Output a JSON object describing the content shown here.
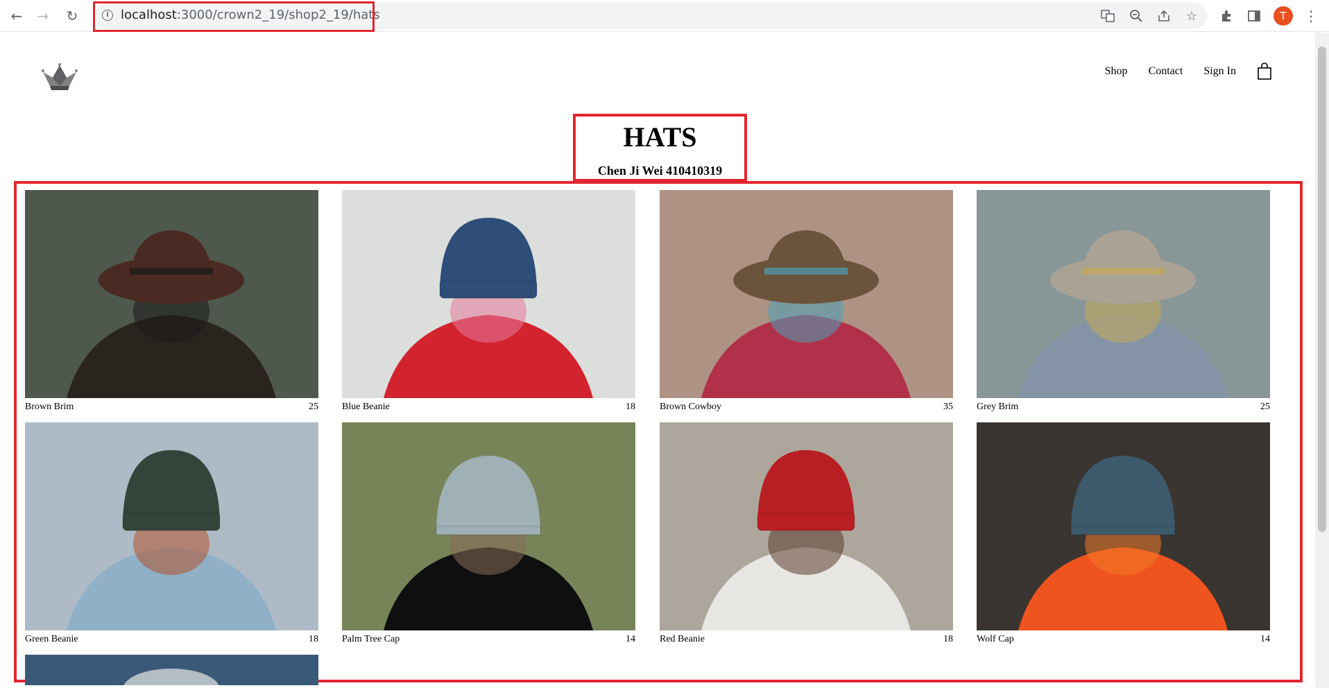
{
  "browser": {
    "url_host": "localhost",
    "url_path": ":3000/crown2_19/shop2_19/hats",
    "avatar_letter": "T"
  },
  "header": {
    "nav": [
      "Shop",
      "Contact",
      "Sign In"
    ]
  },
  "page": {
    "title": "HATS",
    "subtitle": "Chen Ji Wei 410410319"
  },
  "products": [
    {
      "name": "Brown Brim",
      "price": "25",
      "bg": "#3f4a3e",
      "hat": "#4a2a22",
      "body": "#2a241f",
      "accent": "#1a1a18"
    },
    {
      "name": "Blue Beanie",
      "price": "18",
      "bg": "#d9dcd8",
      "hat": "#2e4d78",
      "body": "#d2232f",
      "accent": "#e67a9a"
    },
    {
      "name": "Brown Cowboy",
      "price": "35",
      "bg": "#a88a7a",
      "hat": "#6b543b",
      "body": "#b2314a",
      "accent": "#4aa0b8"
    },
    {
      "name": "Grey Brim",
      "price": "25",
      "bg": "#7e8e8f",
      "hat": "#a9a295",
      "body": "#8494a6",
      "accent": "#c5aa56"
    },
    {
      "name": "Green Beanie",
      "price": "18",
      "bg": "#a8b6c2",
      "hat": "#34443a",
      "body": "#8fb0c6",
      "accent": "#b5542e"
    },
    {
      "name": "Palm Tree Cap",
      "price": "14",
      "bg": "#6c7a4a",
      "hat": "#9fb0b6",
      "body": "#0f0f0f",
      "accent": "#8a6e5a"
    },
    {
      "name": "Red Beanie",
      "price": "18",
      "bg": "#a69f95",
      "hat": "#b81f25",
      "body": "#e8e6e2",
      "accent": "#5b3b2b"
    },
    {
      "name": "Wolf Cap",
      "price": "14",
      "bg": "#2a2420",
      "hat": "#3d5a6c",
      "body": "#f0541e",
      "accent": "#f07a26"
    }
  ]
}
